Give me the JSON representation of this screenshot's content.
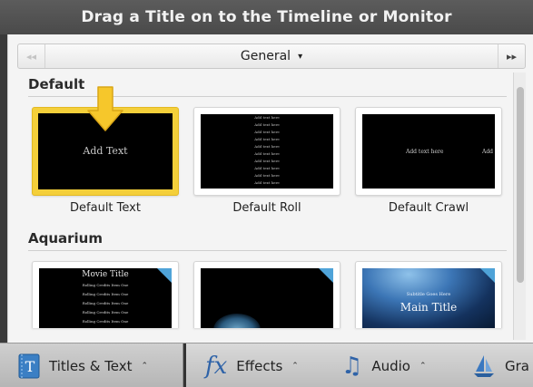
{
  "header": {
    "title": "Drag a Title on to the Timeline or Monitor"
  },
  "selector": {
    "prev_icon": "double-chevron-left-icon",
    "next_icon": "double-chevron-right-icon",
    "prev_glyph": "◂◂",
    "next_glyph": "▸▸",
    "current": "General",
    "caret": "▾"
  },
  "sections": [
    {
      "title": "Default",
      "items": [
        {
          "label": "Default Text",
          "preview_text": "Add Text",
          "selected": true
        },
        {
          "label": "Default Roll",
          "preview_text": "Add text here"
        },
        {
          "label": "Default Crawl",
          "preview_text": "Add text here"
        }
      ]
    },
    {
      "title": "Aquarium",
      "items": [
        {
          "preview_title": "Movie Title",
          "preview_line": "Rolling Credits Item One"
        },
        {
          "preview_title": ""
        },
        {
          "preview_title": "Main Title",
          "preview_line": "Subtitle Goes Here"
        }
      ]
    }
  ],
  "dock": {
    "items": [
      {
        "label": "Titles & Text",
        "icon": "titles-text-icon",
        "icon_glyph": "T",
        "caret": "⌃"
      },
      {
        "label": "Effects",
        "icon": "fx-icon",
        "icon_glyph": "fx",
        "caret": "⌃"
      },
      {
        "label": "Audio",
        "icon": "music-note-icon",
        "icon_glyph": "♫",
        "caret": "⌃"
      },
      {
        "label": "Gra",
        "icon": "sailboat-icon",
        "icon_glyph": "⛵"
      }
    ]
  },
  "colors": {
    "accent_selection": "#f4cf3a",
    "ribbon": "#4fa3d8",
    "titlebar": "#4a4a4a",
    "arrow": "#f6c72b"
  }
}
